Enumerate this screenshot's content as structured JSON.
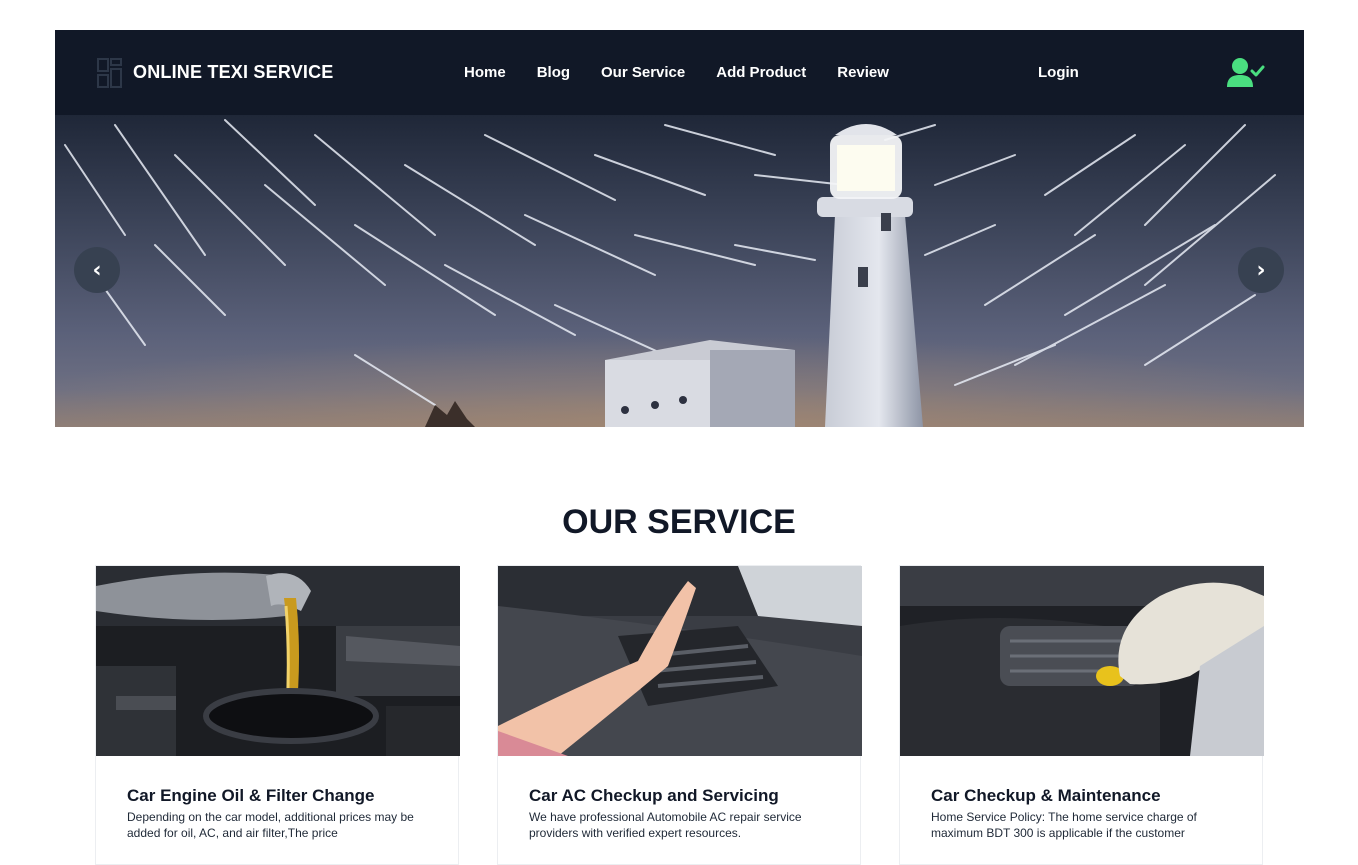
{
  "brand": {
    "name": "ONLINE TEXI SERVICE",
    "logo_icon": "grid-logo-icon"
  },
  "nav": {
    "links": [
      "Home",
      "Blog",
      "Our Service",
      "Add Product",
      "Review"
    ],
    "login": "Login",
    "user_icon": "user-check-icon",
    "user_icon_color": "#4ade80"
  },
  "carousel": {
    "prev_label": "‹",
    "next_label": "›",
    "image": "lighthouse-night-star-trails"
  },
  "services": {
    "title": "OUR SERVICE",
    "items": [
      {
        "title": "Car Engine Oil & Filter Change",
        "text": "Depending on the car model, additional prices may be added for oil, AC, and air filter,The price",
        "image": "oil-pouring-into-engine"
      },
      {
        "title": "Car AC Checkup and Servicing",
        "text": "We have professional Automobile AC repair service providers with verified expert resources.",
        "image": "hand-at-car-ac-vent"
      },
      {
        "title": "Car Checkup & Maintenance",
        "text": "Home Service Policy: The home service charge of maximum BDT 300 is applicable if the customer",
        "image": "gloved-hand-engine-cap"
      }
    ]
  }
}
